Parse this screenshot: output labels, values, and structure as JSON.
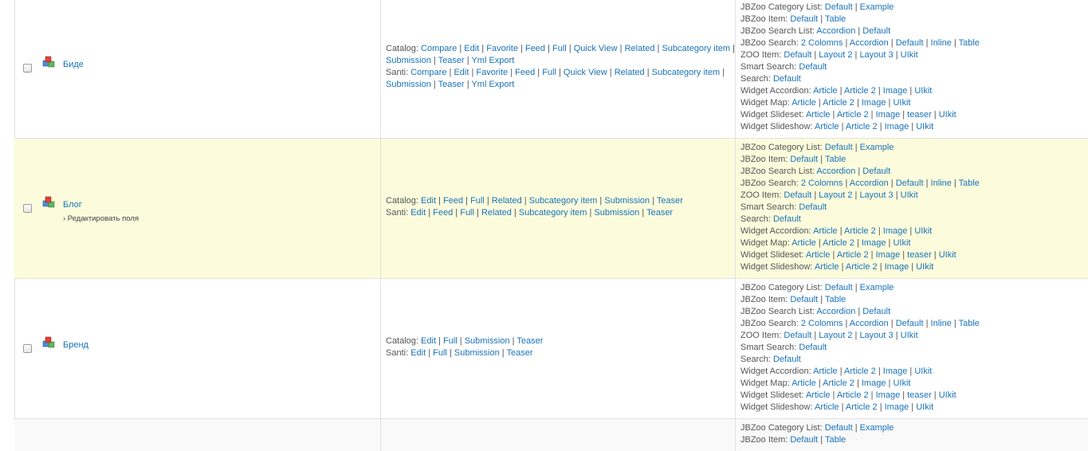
{
  "colors": {
    "link": "#1a73b8",
    "highlight_row": "#fcfcdd",
    "border": "#e1e1e1"
  },
  "rows": [
    {
      "name": "Биде",
      "edit_fields": "",
      "highlighted": false,
      "layouts": [
        {
          "label": "Catalog:",
          "links": [
            "Compare",
            "Edit",
            "Favorite",
            "Feed",
            "Full",
            "Quick View",
            "Related",
            "Subcategory item"
          ],
          "trailing_sep": true
        },
        {
          "label": "",
          "links": [
            "Submission",
            "Teaser",
            "Yml Export"
          ]
        },
        {
          "label": "Santi:",
          "links": [
            "Compare",
            "Edit",
            "Favorite",
            "Feed",
            "Full",
            "Quick View",
            "Related",
            "Subcategory item"
          ],
          "trailing_sep": true
        },
        {
          "label": "",
          "links": [
            "Submission",
            "Teaser",
            "Yml Export"
          ]
        }
      ]
    },
    {
      "name": "Блог",
      "edit_fields": "› Редактировать поля",
      "highlighted": true,
      "layouts": [
        {
          "label": "Catalog:",
          "links": [
            "Edit",
            "Feed",
            "Full",
            "Related",
            "Subcategory item",
            "Submission",
            "Teaser"
          ]
        },
        {
          "label": "Santi:",
          "links": [
            "Edit",
            "Feed",
            "Full",
            "Related",
            "Subcategory item",
            "Submission",
            "Teaser"
          ]
        }
      ]
    },
    {
      "name": "Бренд",
      "edit_fields": "",
      "highlighted": false,
      "layouts": [
        {
          "label": "Catalog:",
          "links": [
            "Edit",
            "Full",
            "Submission",
            "Teaser"
          ]
        },
        {
          "label": "Santi:",
          "links": [
            "Edit",
            "Full",
            "Submission",
            "Teaser"
          ]
        }
      ]
    },
    {
      "name": "",
      "edit_fields": "",
      "highlighted": false,
      "layouts": []
    }
  ],
  "modules": [
    {
      "label": "JBZoo Category List:",
      "links": [
        "Default",
        "Example"
      ]
    },
    {
      "label": "JBZoo Item:",
      "links": [
        "Default",
        "Table"
      ]
    },
    {
      "label": "JBZoo Search List:",
      "links": [
        "Accordion",
        "Default"
      ]
    },
    {
      "label": "JBZoo Search:",
      "links": [
        "2 Colomns",
        "Accordion",
        "Default",
        "Inline",
        "Table"
      ]
    },
    {
      "label": "ZOO Item:",
      "links": [
        "Default",
        "Layout 2",
        "Layout 3",
        "UIkit"
      ]
    },
    {
      "label": "Smart Search:",
      "links": [
        "Default"
      ]
    },
    {
      "label": "Search:",
      "links": [
        "Default"
      ]
    },
    {
      "label": "Widget Accordion:",
      "links": [
        "Article",
        "Article 2",
        "Image",
        "UIkit"
      ]
    },
    {
      "label": "Widget Map:",
      "links": [
        "Article",
        "Article 2",
        "Image",
        "UIkit"
      ]
    },
    {
      "label": "Widget Slideset:",
      "links": [
        "Article",
        "Article 2",
        "Image",
        "teaser",
        "UIkit"
      ]
    },
    {
      "label": "Widget Slideshow:",
      "links": [
        "Article",
        "Article 2",
        "Image",
        "UIkit"
      ]
    }
  ]
}
